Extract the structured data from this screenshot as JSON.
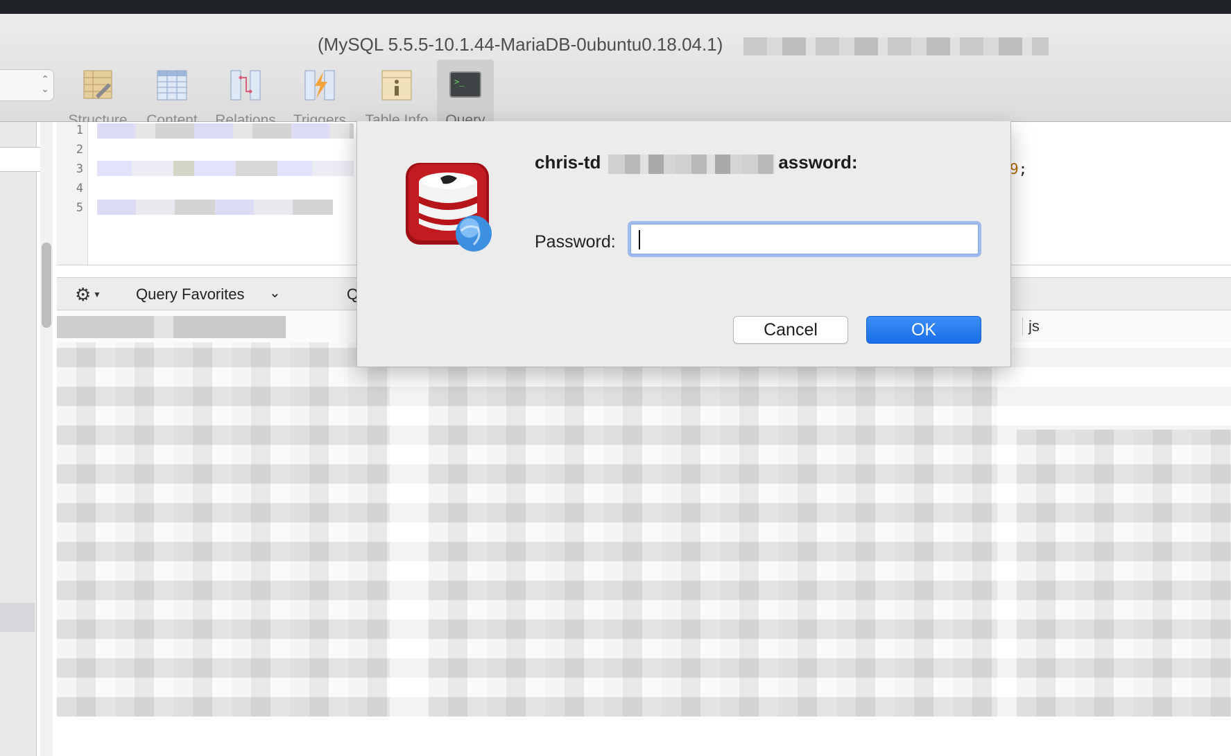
{
  "window": {
    "title": "(MySQL 5.5.5-10.1.44-MariaDB-0ubuntu0.18.04.1)"
  },
  "toolbar": {
    "buttons": [
      {
        "label": "Structure",
        "icon": "structure-icon"
      },
      {
        "label": "Content",
        "icon": "content-icon"
      },
      {
        "label": "Relations",
        "icon": "relations-icon"
      },
      {
        "label": "Triggers",
        "icon": "triggers-icon"
      },
      {
        "label": "Table Info",
        "icon": "table-info-icon"
      },
      {
        "label": "Query",
        "icon": "query-icon",
        "active": true
      }
    ]
  },
  "editor": {
    "line_numbers": [
      "1",
      "2",
      "3",
      "4",
      "5"
    ],
    "visible_fragment_num": "9",
    "visible_fragment_end": ";"
  },
  "query_bar": {
    "gear_icon": "gear-icon",
    "favorites_label": "Query Favorites",
    "partial_label": "Q"
  },
  "results": {
    "visible_column": "js"
  },
  "dialog": {
    "heading_prefix": "chris-td",
    "heading_suffix": "assword:",
    "password_label": "Password:",
    "password_value": "",
    "cancel_label": "Cancel",
    "ok_label": "OK",
    "icon": "sequel-pro-database-globe-icon"
  },
  "colors": {
    "ok_button": "#1a6ee8",
    "focus_ring": "#9dbbef",
    "icon_red": "#b3131b"
  }
}
